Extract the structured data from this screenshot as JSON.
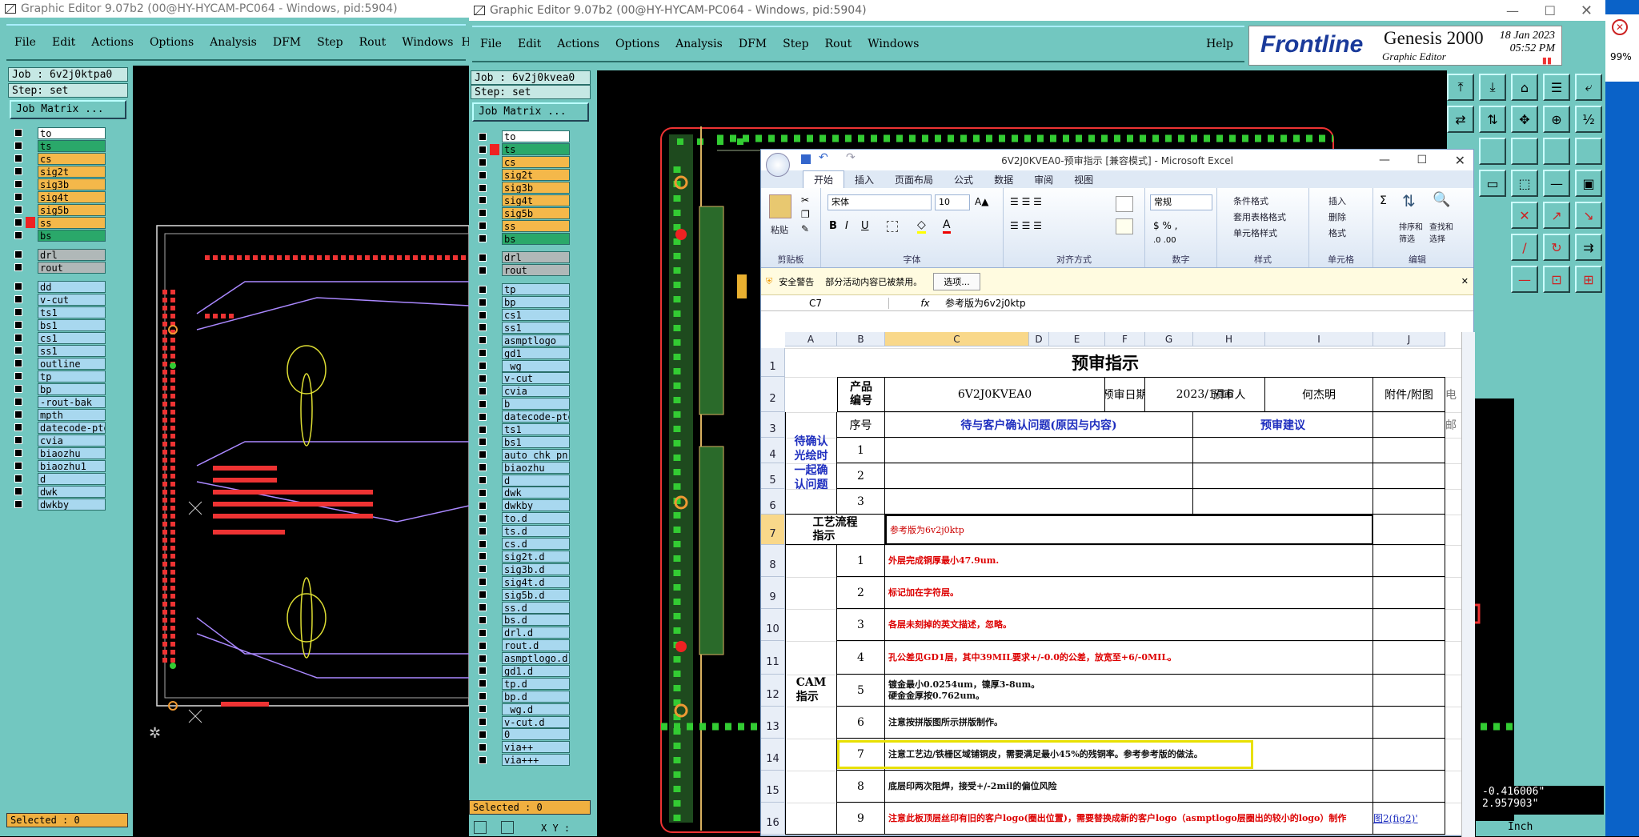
{
  "win1": {
    "title": "Graphic Editor 9.07b2 (00@HY-HYCAM-PC064 - Windows, pid:5904)",
    "menu": [
      "File",
      "Edit",
      "Actions",
      "Options",
      "Analysis",
      "DFM",
      "Step",
      "Rout",
      "Windows"
    ],
    "help": "Help",
    "job": "Job : 6v2j0ktpa0",
    "step": "Step: set",
    "job_matrix": "Job Matrix ...",
    "selected": "Selected : 0",
    "layers_a": [
      "to",
      "ts",
      "cs",
      "sig2t",
      "sig3b",
      "sig4t",
      "sig5b",
      "ss",
      "bs"
    ],
    "layers_b": [
      "drl",
      "rout"
    ],
    "layers_c": [
      "dd",
      "v-cut",
      "ts1",
      "bs1",
      "cs1",
      "ss1",
      "outline",
      "tp",
      "bp",
      "-rout-bak",
      "mpth",
      "datecode-pto",
      "cvia",
      "biaozhu",
      "biaozhu1",
      "d",
      "dwk",
      "dwkby"
    ]
  },
  "win2": {
    "title": "Graphic Editor 9.07b2 (00@HY-HYCAM-PC064 - Windows, pid:5904)",
    "menu": [
      "File",
      "Edit",
      "Actions",
      "Options",
      "Analysis",
      "DFM",
      "Step",
      "Rout",
      "Windows"
    ],
    "help": "Help",
    "job": "Job : 6v2j0kvea0",
    "step": "Step: set",
    "job_matrix": "Job Matrix ...",
    "selected": "Selected : 0",
    "brand": "Frontline",
    "product": "Genesis 2000",
    "product_sub": "Graphic Editor",
    "date": "18 Jan 2023",
    "time": "05:52 PM",
    "coord1": "-0.416006\"",
    "coord2": "2.957903\"",
    "units": "Inch",
    "xy_label": "X Y :",
    "layers_a": [
      "to",
      "ts",
      "cs",
      "sig2t",
      "sig3b",
      "sig4t",
      "sig5b",
      "ss",
      "bs"
    ],
    "layers_b": [
      "drl",
      "rout"
    ],
    "layers_c": [
      "tp",
      "bp",
      "cs1",
      "ss1",
      "asmptlogo",
      "gd1",
      "_wg",
      "v-cut",
      "cvia",
      "b",
      "datecode-pto",
      "ts1",
      "bs1",
      "auto_chk_pn",
      "biaozhu",
      "d",
      "dwk",
      "dwkby",
      "to.d",
      "ts.d",
      "cs.d",
      "sig2t.d",
      "sig3b.d",
      "sig4t.d",
      "sig5b.d",
      "ss.d",
      "bs.d",
      "drl.d",
      "rout.d",
      "asmptlogo.d",
      "gd1.d",
      "tp.d",
      "bp.d",
      "_wg.d",
      "v-cut.d",
      "0",
      "via++",
      "via+++"
    ]
  },
  "side": {
    "percent": "99%"
  },
  "excel": {
    "title": "6V2J0KVEA0-预审指示  [兼容模式] - Microsoft Excel",
    "tabs": [
      "开始",
      "插入",
      "页面布局",
      "公式",
      "数据",
      "审阅",
      "视图"
    ],
    "font": "宋体",
    "size": "10",
    "numfmt": "常规",
    "groups": [
      "剪贴板",
      "字体",
      "对齐方式",
      "数字",
      "样式",
      "单元格",
      "编辑"
    ],
    "paste": "粘贴",
    "style_btns": [
      "条件格式",
      "套用表格格式",
      "单元格样式"
    ],
    "cell_btns": [
      "插入",
      "删除",
      "格式"
    ],
    "edit_btns": [
      "排序和\n筛选",
      "查找和\n选择"
    ],
    "security_label": "安全警告",
    "security_msg": "部分活动内容已被禁用。",
    "options": "选项...",
    "namebox": "C7",
    "fx": "fx",
    "formula": "参考版为6v2j0ktp",
    "cols": [
      "A",
      "B",
      "C",
      "D",
      "E",
      "F",
      "G",
      "H",
      "I",
      "J"
    ],
    "rows": [
      "1",
      "2",
      "3",
      "4",
      "5",
      "6",
      "7",
      "8",
      "9",
      "10",
      "11",
      "12",
      "13",
      "14",
      "15",
      "16"
    ],
    "sheet_title": "预审指示",
    "r2": {
      "a": "产品\n编号",
      "b": "6V2J0KVEA0",
      "c": "预审日期",
      "d": "2023/1/16",
      "e": "预审人",
      "f": "何杰明",
      "g": "附件/附图",
      "h": "电"
    },
    "r3": {
      "b": "序号",
      "c": "待与客户确认问题(原因与内容)",
      "h": "预审建议",
      "k": "邮"
    },
    "confirm_label": "待确认\n光绘时\n一起确\n认问题",
    "q": [
      "1",
      "2",
      "3"
    ],
    "r7": {
      "a": "工艺流程\n指示",
      "c": "参考版为6v2j0ktp"
    },
    "cam_label": "CAM\n指示",
    "items": [
      {
        "n": "1",
        "t": "外层完成铜厚最小47.9um.",
        "red": true
      },
      {
        "n": "2",
        "t": "标记加在字符层。",
        "red": true
      },
      {
        "n": "3",
        "t": "各层未刻掉的英文描述，忽略。",
        "red": true
      },
      {
        "n": "4",
        "t": "孔公差见GD1层，其中39MIL要求+/-0.0的公差，放宽至+6/-0MIL。",
        "red": true
      },
      {
        "n": "5",
        "t": "镀金最小0.0254um，镍厚3-8um。\n硬金金厚按0.762um。",
        "red": false
      },
      {
        "n": "6",
        "t": "注意按拼版图所示拼版制作。",
        "red": false
      },
      {
        "n": "7",
        "t": "注意工艺边/铁栅区域铺铜皮，需要满足最小45%的残铜率。参考参考版的做法。",
        "red": false
      },
      {
        "n": "8",
        "t": "底层印两次阻焊，接受+/-2mil的偏位风险",
        "red": false
      },
      {
        "n": "9",
        "t": "注意此板顶层丝印有旧的客户logo(圈出位置)，需要替换成新的客户logo（asmptlogo层圈出的较小的logo）制作",
        "red": true
      }
    ],
    "attach9": "图2(fig2)'"
  }
}
